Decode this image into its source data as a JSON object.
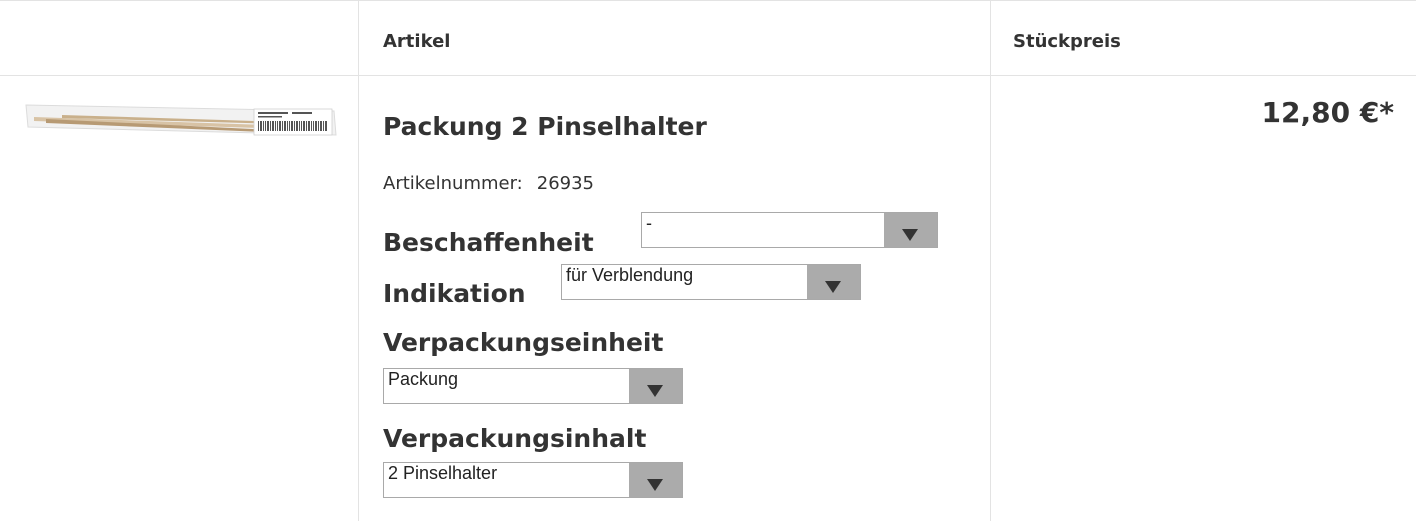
{
  "table": {
    "col_article": "Artikel",
    "col_price": "Stückpreis"
  },
  "product": {
    "image_icon": "product-thumbnail-image",
    "title": "Packung 2 Pinselhalter",
    "article_number_label": "Artikelnummer:",
    "article_number": "26935",
    "price": "12,80 €*",
    "options": {
      "beschaffenheit": {
        "label": "Beschaffenheit",
        "value": "-"
      },
      "indikation": {
        "label": "Indikation",
        "value": "für Verblendung"
      },
      "verpackungseinheit": {
        "label": "Verpackungseinheit",
        "value": "Packung"
      },
      "verpackungsinhalt": {
        "label": "Verpackungsinhalt",
        "value": "2 Pinselhalter"
      }
    }
  },
  "icons": {
    "dropdown": "chevron-down-icon"
  }
}
